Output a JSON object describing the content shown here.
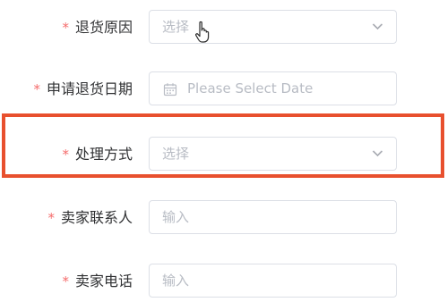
{
  "form": {
    "fields": [
      {
        "label": "退货原因",
        "required_mark": "*",
        "placeholder": "选择",
        "type": "select"
      },
      {
        "label": "申请退货日期",
        "required_mark": "*",
        "placeholder": "Please Select Date",
        "type": "date"
      },
      {
        "label": "处理方式",
        "required_mark": "*",
        "placeholder": "选择",
        "type": "select"
      },
      {
        "label": "卖家联系人",
        "required_mark": "*",
        "placeholder": "输入",
        "type": "text"
      },
      {
        "label": "卖家电话",
        "required_mark": "*",
        "placeholder": "输入",
        "type": "text"
      }
    ]
  },
  "icons": {
    "select_arrow": "chevron-down-icon",
    "date": "calendar-icon",
    "pointer": "hand-pointer-icon"
  },
  "colors": {
    "required": "#f56c6c",
    "highlight": "#e8502e",
    "border": "#dcdfe6",
    "placeholder": "#b8bcc4",
    "label": "#303133"
  }
}
